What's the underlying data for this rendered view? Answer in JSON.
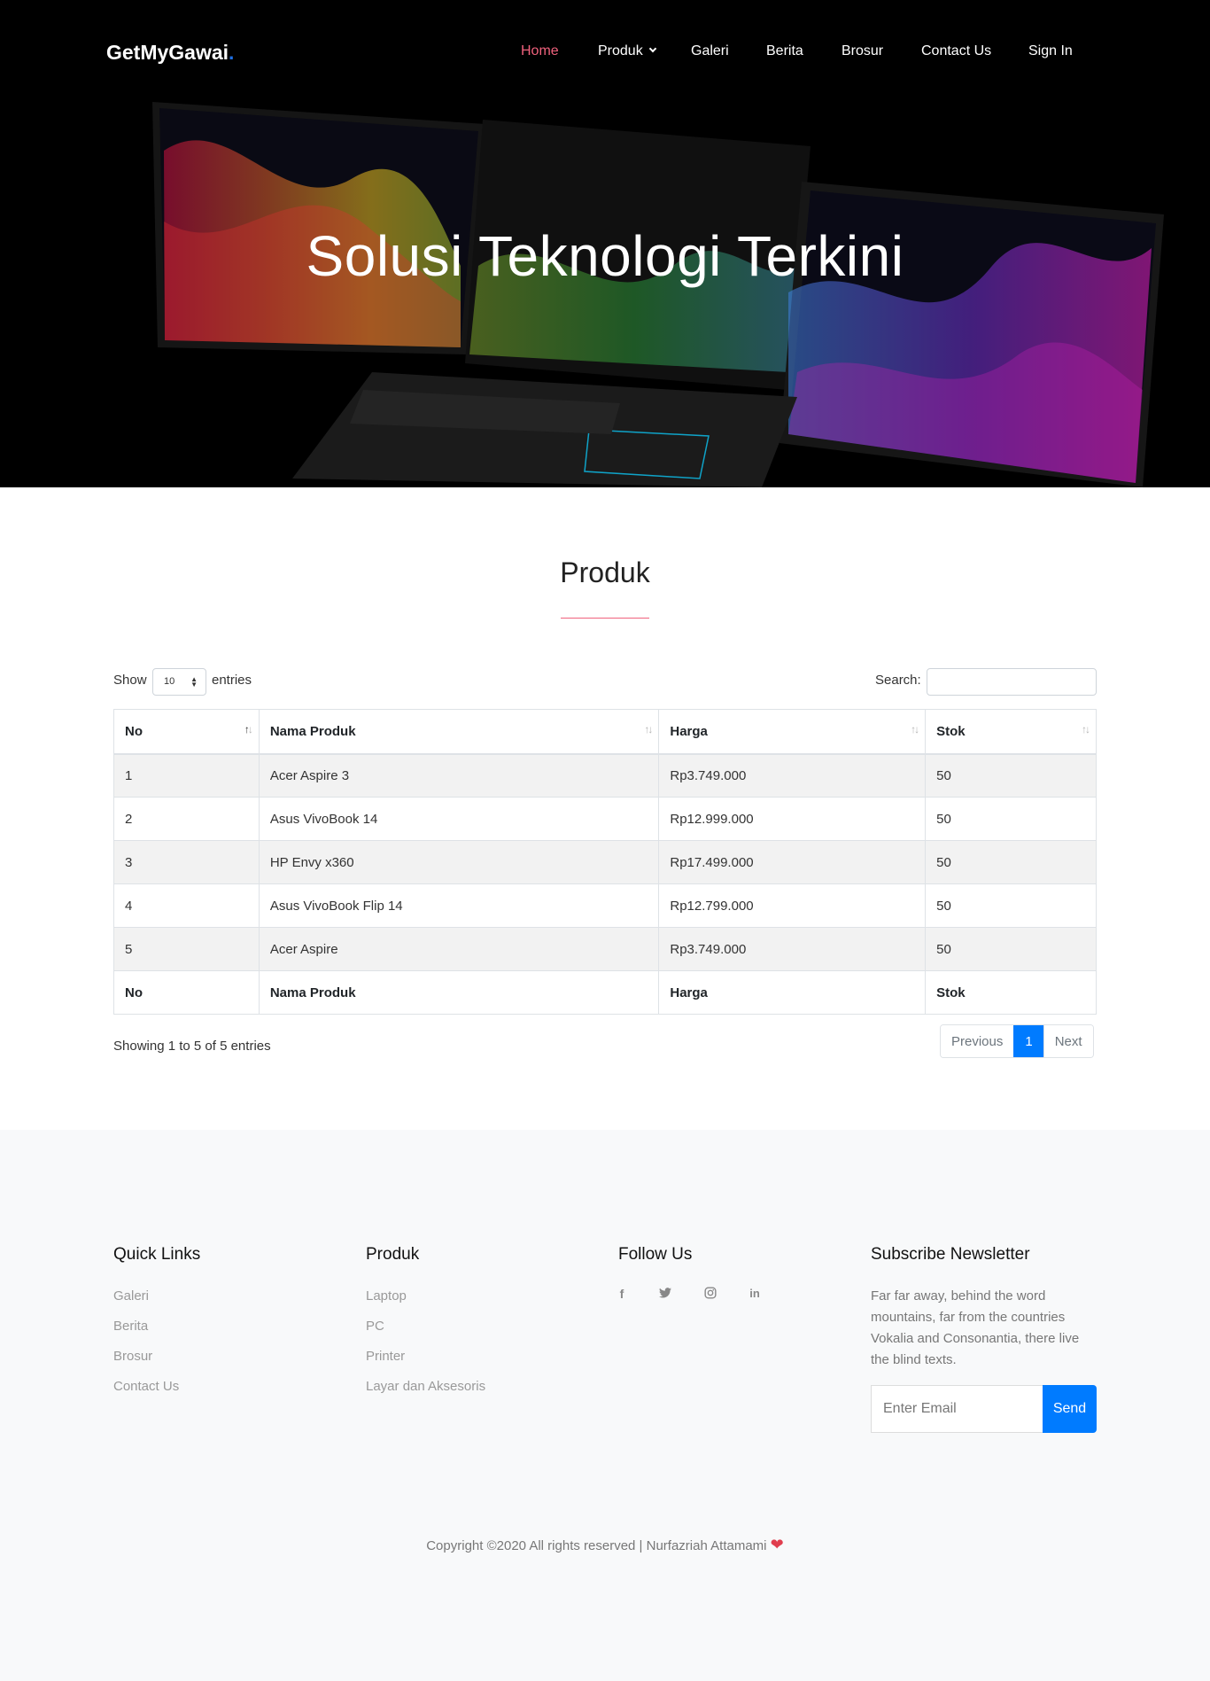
{
  "brand": {
    "name": "GetMyGawai",
    "dot": "."
  },
  "nav": {
    "items": [
      {
        "label": "Home",
        "active": true
      },
      {
        "label": "Produk",
        "dropdown": true
      },
      {
        "label": "Galeri"
      },
      {
        "label": "Berita"
      },
      {
        "label": "Brosur"
      },
      {
        "label": "Contact Us"
      },
      {
        "label": "Sign In"
      }
    ],
    "active_color": "#f0627d"
  },
  "hero": {
    "title": "Solusi Teknologi Terkini"
  },
  "products": {
    "title": "Produk",
    "length": {
      "show_label": "Show",
      "value": "10",
      "entries_label": "entries"
    },
    "search": {
      "label": "Search:",
      "value": ""
    },
    "columns": [
      "No",
      "Nama Produk",
      "Harga",
      "Stok"
    ],
    "rows": [
      [
        "1",
        "Acer Aspire 3",
        "Rp3.749.000",
        "50"
      ],
      [
        "2",
        "Asus VivoBook 14",
        "Rp12.999.000",
        "50"
      ],
      [
        "3",
        "HP Envy x360",
        "Rp17.499.000",
        "50"
      ],
      [
        "4",
        "Asus VivoBook Flip 14",
        "Rp12.799.000",
        "50"
      ],
      [
        "5",
        "Acer Aspire",
        "Rp3.749.000",
        "50"
      ]
    ],
    "info": "Showing 1 to 5 of 5 entries",
    "pagination": {
      "previous": "Previous",
      "current": "1",
      "next": "Next"
    }
  },
  "footer": {
    "quick_links": {
      "title": "Quick Links",
      "items": [
        "Galeri",
        "Berita",
        "Brosur",
        "Contact Us"
      ]
    },
    "produk": {
      "title": "Produk",
      "items": [
        "Laptop",
        "PC",
        "Printer",
        "Layar dan Aksesoris"
      ]
    },
    "follow": {
      "title": "Follow Us",
      "icons": [
        "facebook-icon",
        "twitter-icon",
        "instagram-icon",
        "linkedin-icon"
      ]
    },
    "newsletter": {
      "title": "Subscribe Newsletter",
      "text": "Far far away, behind the word mountains, far from the countries Vokalia and Consonantia, there live the blind texts.",
      "placeholder": "Enter Email",
      "button": "Send"
    },
    "copyright": "Copyright ©2020 All rights reserved | Nurfazriah Attamami"
  },
  "colors": {
    "accent": "#f0627d",
    "primary": "#007bff",
    "footer_bg": "#f8f9fa"
  }
}
